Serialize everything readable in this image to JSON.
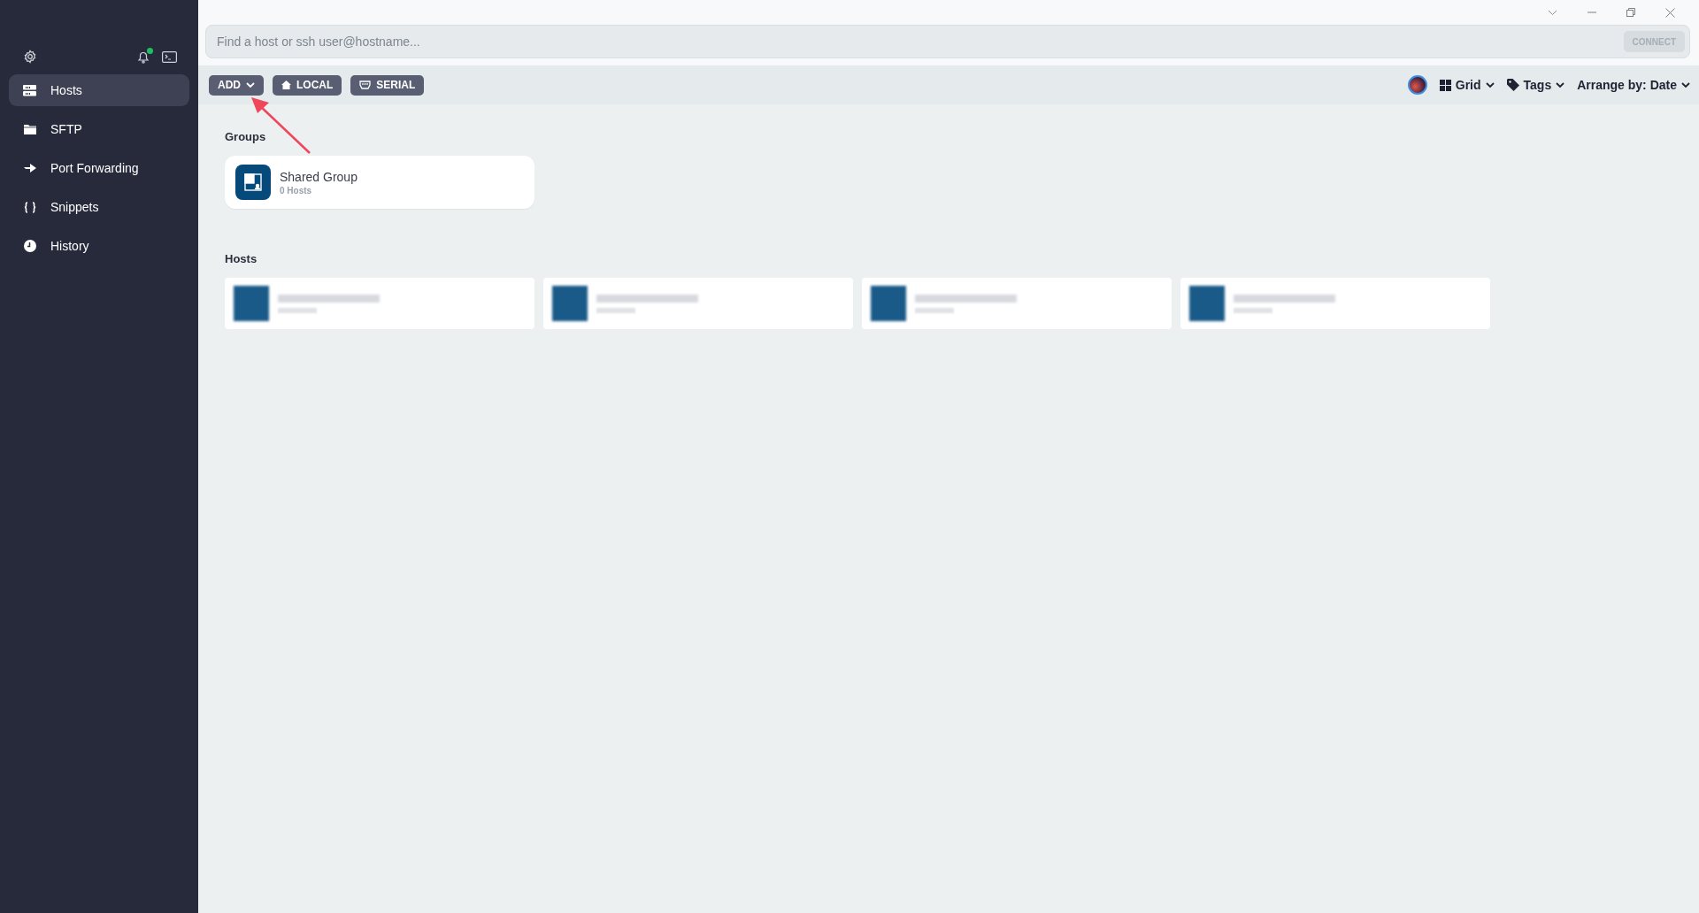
{
  "sidebar": {
    "notifications_unread": true,
    "items": [
      {
        "label": "Hosts",
        "kind": "hosts",
        "selected": true
      },
      {
        "label": "SFTP",
        "kind": "sftp",
        "selected": false
      },
      {
        "label": "Port Forwarding",
        "kind": "forwarding",
        "selected": false
      },
      {
        "label": "Snippets",
        "kind": "snippets",
        "selected": false
      },
      {
        "label": "History",
        "kind": "history",
        "selected": false
      }
    ]
  },
  "search": {
    "placeholder": "Find a host or ssh user@hostname...",
    "button": "CONNECT",
    "button_disabled": true
  },
  "toolbar": {
    "buttons": [
      {
        "label": "ADD",
        "kind": "dropdown"
      },
      {
        "label": "LOCAL",
        "kind": "local"
      },
      {
        "label": "SERIAL",
        "kind": "serial"
      }
    ],
    "view": [
      {
        "label": "Grid",
        "kind": "grid"
      },
      {
        "label": "Tags",
        "kind": "tags"
      },
      {
        "label": "Arrange by: Date",
        "kind": "arrange"
      }
    ]
  },
  "groups": {
    "title": "Groups",
    "items": [
      {
        "name": "Shared Group",
        "count": "0 Hosts"
      }
    ]
  },
  "hosts": {
    "title": "Hosts",
    "items": [
      {
        "kind": "redacted"
      },
      {
        "kind": "redacted"
      },
      {
        "kind": "redacted"
      },
      {
        "kind": "redacted"
      }
    ]
  }
}
